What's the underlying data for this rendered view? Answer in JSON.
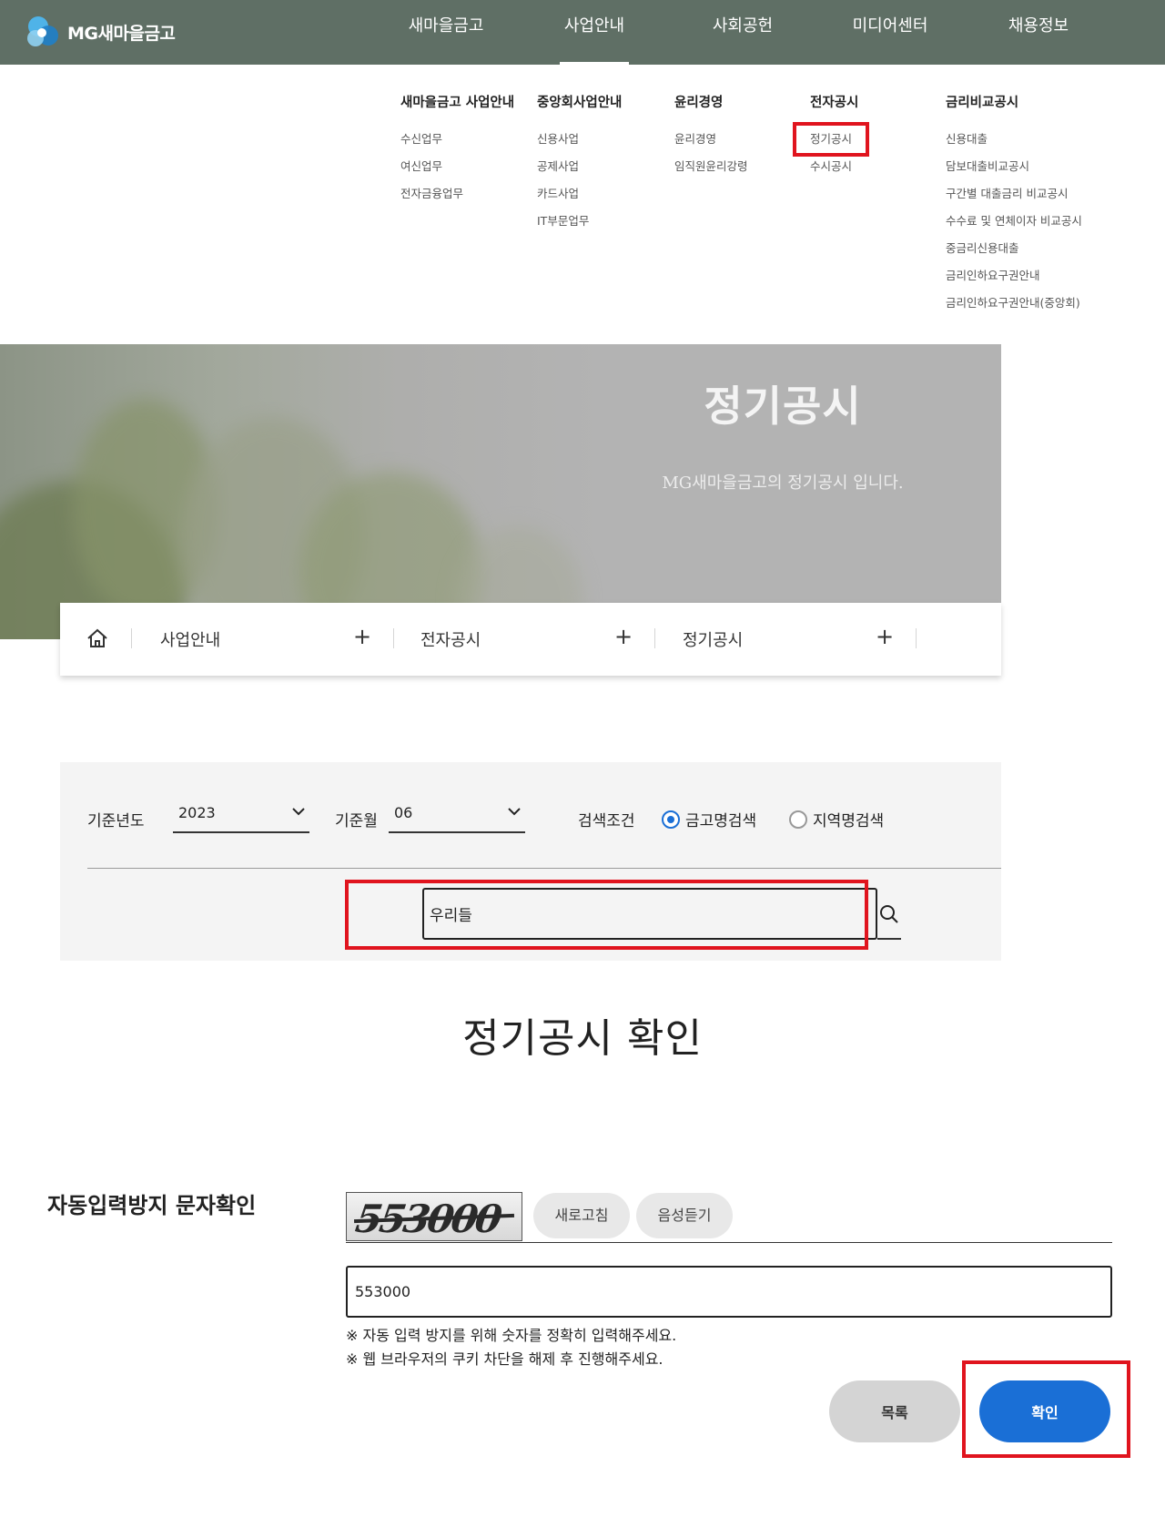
{
  "header": {
    "logo_text": "MG새마을금고",
    "nav": [
      "새마을금고",
      "사업안내",
      "사회공헌",
      "미디어센터",
      "채용정보"
    ],
    "active_nav": "사업안내"
  },
  "mega_menu": {
    "columns": [
      {
        "title": "새마을금고 사업안내",
        "items": [
          "수신업무",
          "여신업무",
          "전자금융업무"
        ]
      },
      {
        "title": "중앙회사업안내",
        "items": [
          "신용사업",
          "공제사업",
          "카드사업",
          "IT부문업무"
        ]
      },
      {
        "title": "윤리경영",
        "items": [
          "윤리경영",
          "임직원윤리강령"
        ]
      },
      {
        "title": "전자공시",
        "items": [
          "정기공시",
          "수시공시"
        ]
      },
      {
        "title": "금리비교공시",
        "items": [
          "신용대출",
          "담보대출비교공시",
          "구간별 대출금리 비교공시",
          "수수료 및 연체이자 비교공시",
          "중금리신용대출",
          "금리인하요구권안내",
          "금리인하요구권안내(중앙회)"
        ]
      }
    ]
  },
  "banner": {
    "title": "정기공시",
    "subtitle": "MG새마을금고의 정기공시 입니다."
  },
  "breadcrumb": [
    "사업안내",
    "전자공시",
    "정기공시"
  ],
  "search": {
    "year_label": "기준년도",
    "year_value": "2023",
    "month_label": "기준월",
    "month_value": "06",
    "condition_label": "검색조건",
    "radio_options": [
      "금고명검색",
      "지역명검색"
    ],
    "selected_option": "금고명검색",
    "query": "우리들"
  },
  "confirm": {
    "title": "정기공시 확인",
    "captcha_label": "자동입력방지 문자확인",
    "captcha_text": "553000",
    "refresh_label": "새로고침",
    "audio_label": "음성듣기",
    "input_value": "553000",
    "notes": [
      "※ 자동 입력 방지를 위해 숫자를 정확히 입력해주세요.",
      "※ 웹 브라우저의 쿠키 차단을 해제 후 진행해주세요."
    ],
    "list_button": "목록",
    "ok_button": "확인"
  },
  "colors": {
    "header_bg": "#5f6f65",
    "accent_blue": "#1a6fd6",
    "highlight_red": "#e0141e"
  }
}
